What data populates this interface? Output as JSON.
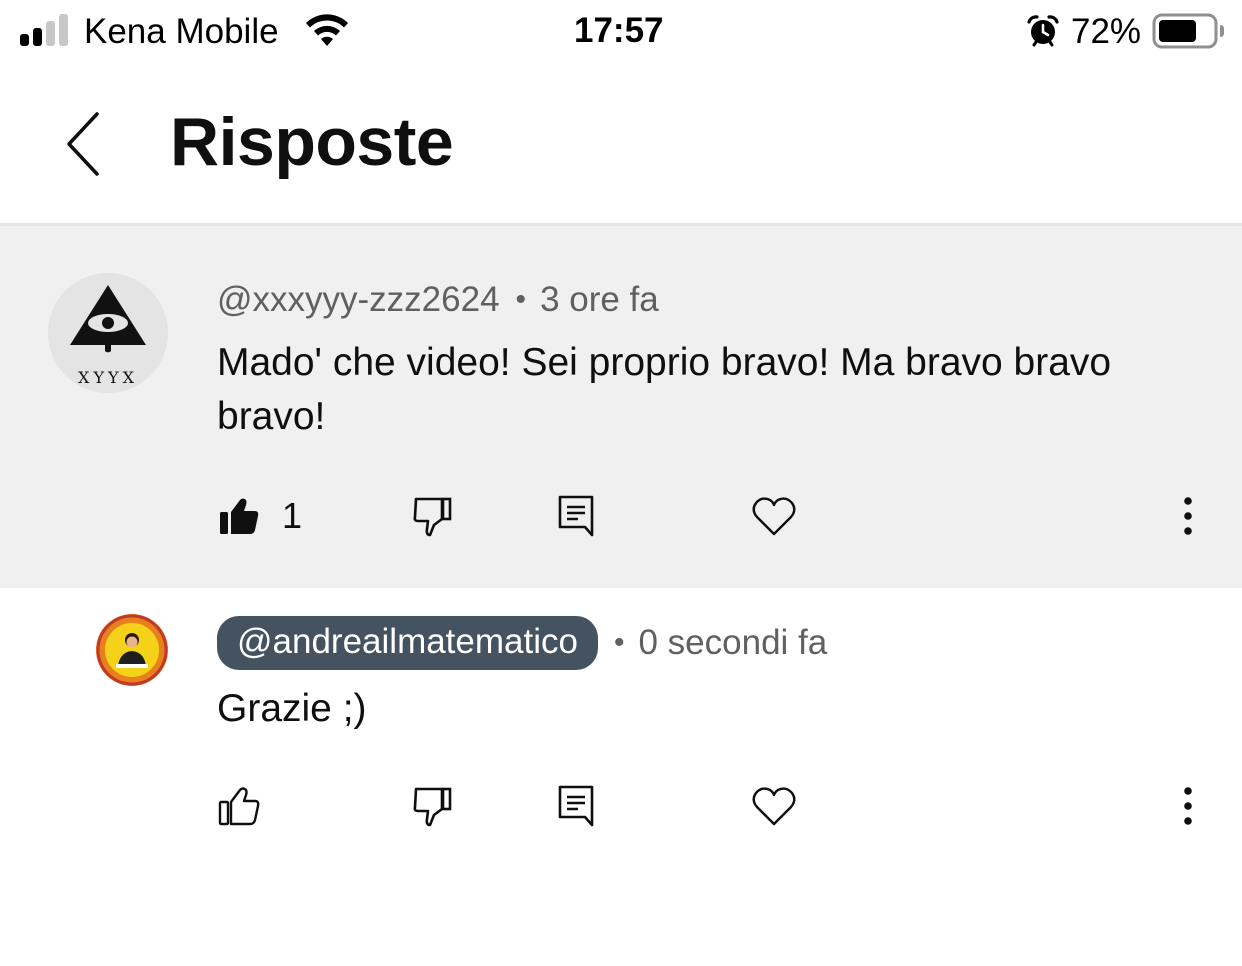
{
  "status_bar": {
    "carrier": "Kena Mobile",
    "time": "17:57",
    "battery_percent": "72%",
    "battery_level": 0.72,
    "signal_bars_filled": 2,
    "signal_bars_total": 4,
    "icons": [
      "signal-icon",
      "wifi-icon",
      "alarm-icon",
      "battery-icon"
    ]
  },
  "header": {
    "title": "Risposte",
    "back_icon": "chevron-left-icon"
  },
  "comments": [
    {
      "author": "@xxxyyy-zzz2624",
      "time_ago": "3 ore fa",
      "text": "Mado' che video! Sei proprio bravo! Ma bravo bravo bravo!",
      "like_count": "1",
      "liked": true,
      "highlighted": true,
      "avatar_text": "XYYX",
      "actions": [
        "thumbs-up-icon",
        "thumbs-down-icon",
        "reply-icon",
        "heart-icon",
        "more-vert-icon"
      ]
    },
    {
      "author": "@andreailmatematico",
      "time_ago": "0 secondi fa",
      "text": "Grazie ;)",
      "like_count": "",
      "liked": false,
      "highlighted": false,
      "is_creator": true,
      "actions": [
        "thumbs-up-icon",
        "thumbs-down-icon",
        "reply-icon",
        "heart-icon",
        "more-vert-icon"
      ]
    }
  ],
  "separator": "•",
  "colors": {
    "highlight_bg": "#f0f0f0",
    "creator_pill": "#455361",
    "meta_text": "#606060",
    "text": "#0f0f0f"
  }
}
